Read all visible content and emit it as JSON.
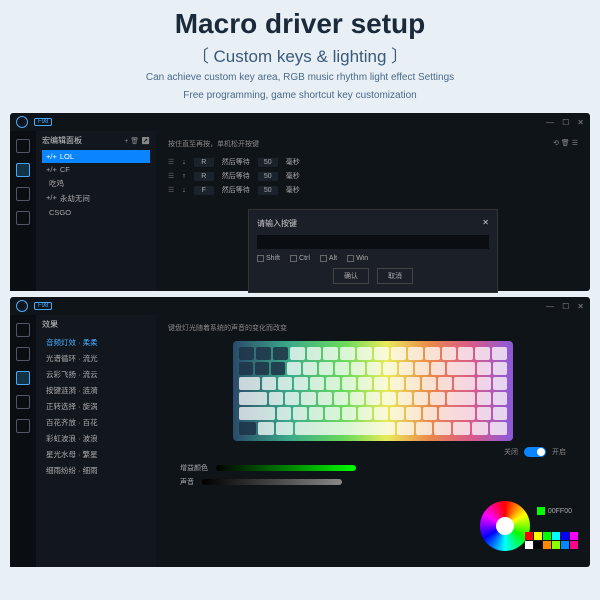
{
  "hero": {
    "title": "Macro driver setup",
    "subtitle": "〔 Custom keys & lighting 〕",
    "desc1": "Can achieve custom key area, RGB music rhythm light effect Settings",
    "desc2": "Free programming, game shortcut key customization"
  },
  "app1": {
    "badge": "F98",
    "panel_title": "宏编辑面板",
    "macros": [
      {
        "prefix": "+/+",
        "name": "LOL",
        "active": true
      },
      {
        "prefix": "+/+",
        "name": "CF"
      },
      {
        "prefix": "</>",
        "name": "吃鸡"
      },
      {
        "prefix": "+/+",
        "name": "永劫无间"
      },
      {
        "prefix": "</>",
        "name": "CSGO"
      }
    ],
    "content_head_left": "按住直至再按，单机松开按键",
    "content_head_icons": "⟲ 🗑 ☰",
    "seq": [
      {
        "arrow": "↓",
        "key": "R",
        "label": "然后等待",
        "val": "50",
        "unit": "毫秒"
      },
      {
        "arrow": "↑",
        "key": "R",
        "label": "然后等待",
        "val": "50",
        "unit": "毫秒"
      },
      {
        "arrow": "↓",
        "key": "F",
        "label": "然后等待",
        "val": "50",
        "unit": "毫秒"
      }
    ],
    "dialog": {
      "title": "请输入按键",
      "checks": [
        "Shift",
        "Ctrl",
        "Alt",
        "Win"
      ],
      "ok": "确认",
      "cancel": "取消"
    }
  },
  "app2": {
    "badge": "F98",
    "panel_title": "效果",
    "effects": [
      {
        "name": "音频灯效 · 柔柔",
        "active": true
      },
      {
        "name": "光谱循环 · 流光"
      },
      {
        "name": "云彩飞扬 · 流云"
      },
      {
        "name": "按键涟漪 · 涟漪"
      },
      {
        "name": "正转选择 · 旋涡"
      },
      {
        "name": "百花齐放 · 百花"
      },
      {
        "name": "彩虹波浪 · 波浪"
      },
      {
        "name": "星光水母 · 繁星"
      },
      {
        "name": "细雨纷纷 · 细雨"
      }
    ],
    "kb_desc": "键盘灯光随着系统的声音的变化而改变",
    "toggle": {
      "off": "关闭",
      "on": "开启"
    },
    "colors": {
      "label1": "增益颜色",
      "label2": "声音",
      "hex": "00FF00"
    },
    "swatches": [
      "#ff0000",
      "#ffff00",
      "#00ff00",
      "#00ffff",
      "#0000ff",
      "#ff00ff",
      "#ffffff",
      "#000000",
      "#ff8800",
      "#88ff00",
      "#0088ff",
      "#ff0088"
    ]
  }
}
